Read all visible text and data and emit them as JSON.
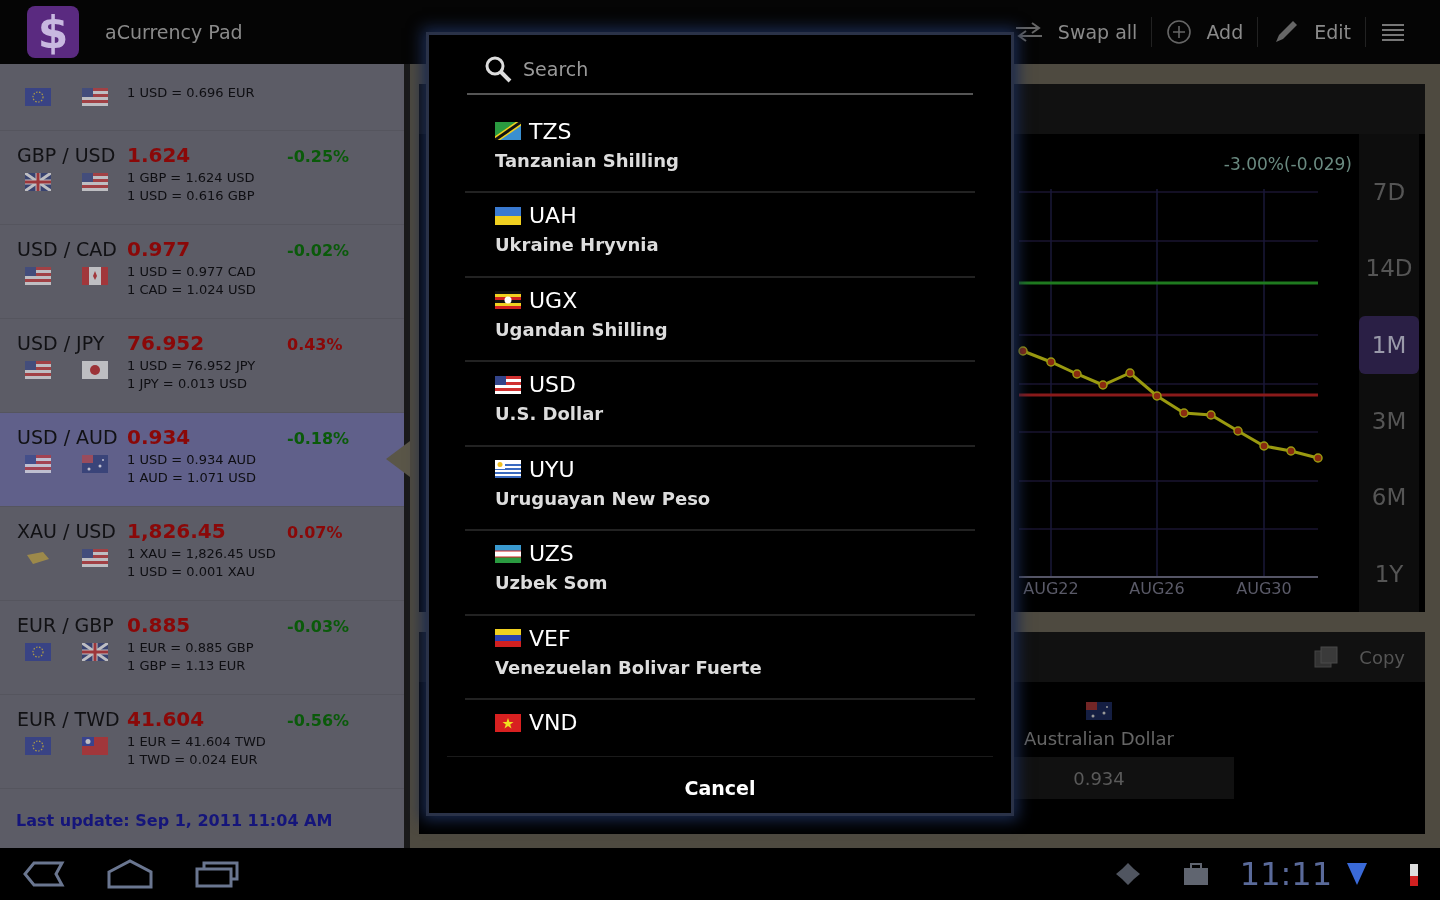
{
  "app": {
    "logo_glyph": "$",
    "title": "aCurrency Pad"
  },
  "actions": [
    {
      "kind": "swap",
      "label": "Swap all"
    },
    {
      "kind": "add",
      "label": "Add"
    },
    {
      "kind": "edit",
      "label": "Edit"
    },
    {
      "kind": "menu"
    }
  ],
  "pairs_top": {
    "line": "1 USD = 0.696 EUR"
  },
  "pairs": [
    {
      "pair": "GBP / USD",
      "rate": "1.624",
      "change": "-0.25%",
      "color": "#0a5a0a",
      "lines": [
        "1 GBP = 1.624 USD",
        "1 USD = 0.616 GBP"
      ],
      "selected": false
    },
    {
      "pair": "USD / CAD",
      "rate": "0.977",
      "change": "-0.02%",
      "color": "#0a5a0a",
      "lines": [
        "1 USD = 0.977 CAD",
        "1 CAD = 1.024 USD"
      ],
      "selected": false
    },
    {
      "pair": "USD / JPY",
      "rate": "76.952",
      "change": "0.43%",
      "color": "#8a0808",
      "lines": [
        "1 USD = 76.952 JPY",
        "1 JPY = 0.013 USD"
      ],
      "selected": false
    },
    {
      "pair": "USD / AUD",
      "rate": "0.934",
      "change": "-0.18%",
      "color": "#0a5a0a",
      "lines": [
        "1 USD = 0.934 AUD",
        "1 AUD = 1.071 USD"
      ],
      "selected": true
    },
    {
      "pair": "XAU / USD",
      "rate": "1,826.45",
      "change": "0.07%",
      "color": "#8a0808",
      "lines": [
        "1 XAU = 1,826.45 USD",
        "1 USD = 0.001 XAU"
      ],
      "selected": false
    },
    {
      "pair": "EUR / GBP",
      "rate": "0.885",
      "change": "-0.03%",
      "color": "#0a5a0a",
      "lines": [
        "1 EUR = 0.885 GBP",
        "1 GBP = 1.13 EUR"
      ],
      "selected": false
    },
    {
      "pair": "EUR / TWD",
      "rate": "41.604",
      "change": "-0.56%",
      "color": "#0a5a0a",
      "lines": [
        "1 EUR = 41.604 TWD",
        "1 TWD = 0.024 EUR"
      ],
      "selected": false
    }
  ],
  "last_update": "Last update: Sep 1, 2011 11:04 AM",
  "chart": {
    "change": "-3.00%(-0.029)",
    "x_labels": [
      "AUG22",
      "AUG26",
      "AUG30"
    ]
  },
  "periods": [
    {
      "label": "7D",
      "selected": false
    },
    {
      "label": "14D",
      "selected": false
    },
    {
      "label": "1M",
      "selected": true
    },
    {
      "label": "3M",
      "selected": false
    },
    {
      "label": "6M",
      "selected": false
    },
    {
      "label": "1Y",
      "selected": false
    }
  ],
  "converter": {
    "copy": "Copy",
    "currency": "Australian Dollar",
    "value": "0.934"
  },
  "dialog": {
    "search": {
      "placeholder": "Search"
    },
    "items": [
      {
        "code": "TZS",
        "name": "Tanzanian Shilling"
      },
      {
        "code": "UAH",
        "name": "Ukraine Hryvnia"
      },
      {
        "code": "UGX",
        "name": "Ugandan Shilling"
      },
      {
        "code": "USD",
        "name": "U.S. Dollar"
      },
      {
        "code": "UYU",
        "name": "Uruguayan New Peso"
      },
      {
        "code": "UZS",
        "name": "Uzbek Som"
      },
      {
        "code": "VEF",
        "name": "Venezuelan Bolivar Fuerte"
      },
      {
        "code": "VND"
      }
    ],
    "cancel": "Cancel"
  },
  "status_bar": {
    "time": "11:11"
  }
}
